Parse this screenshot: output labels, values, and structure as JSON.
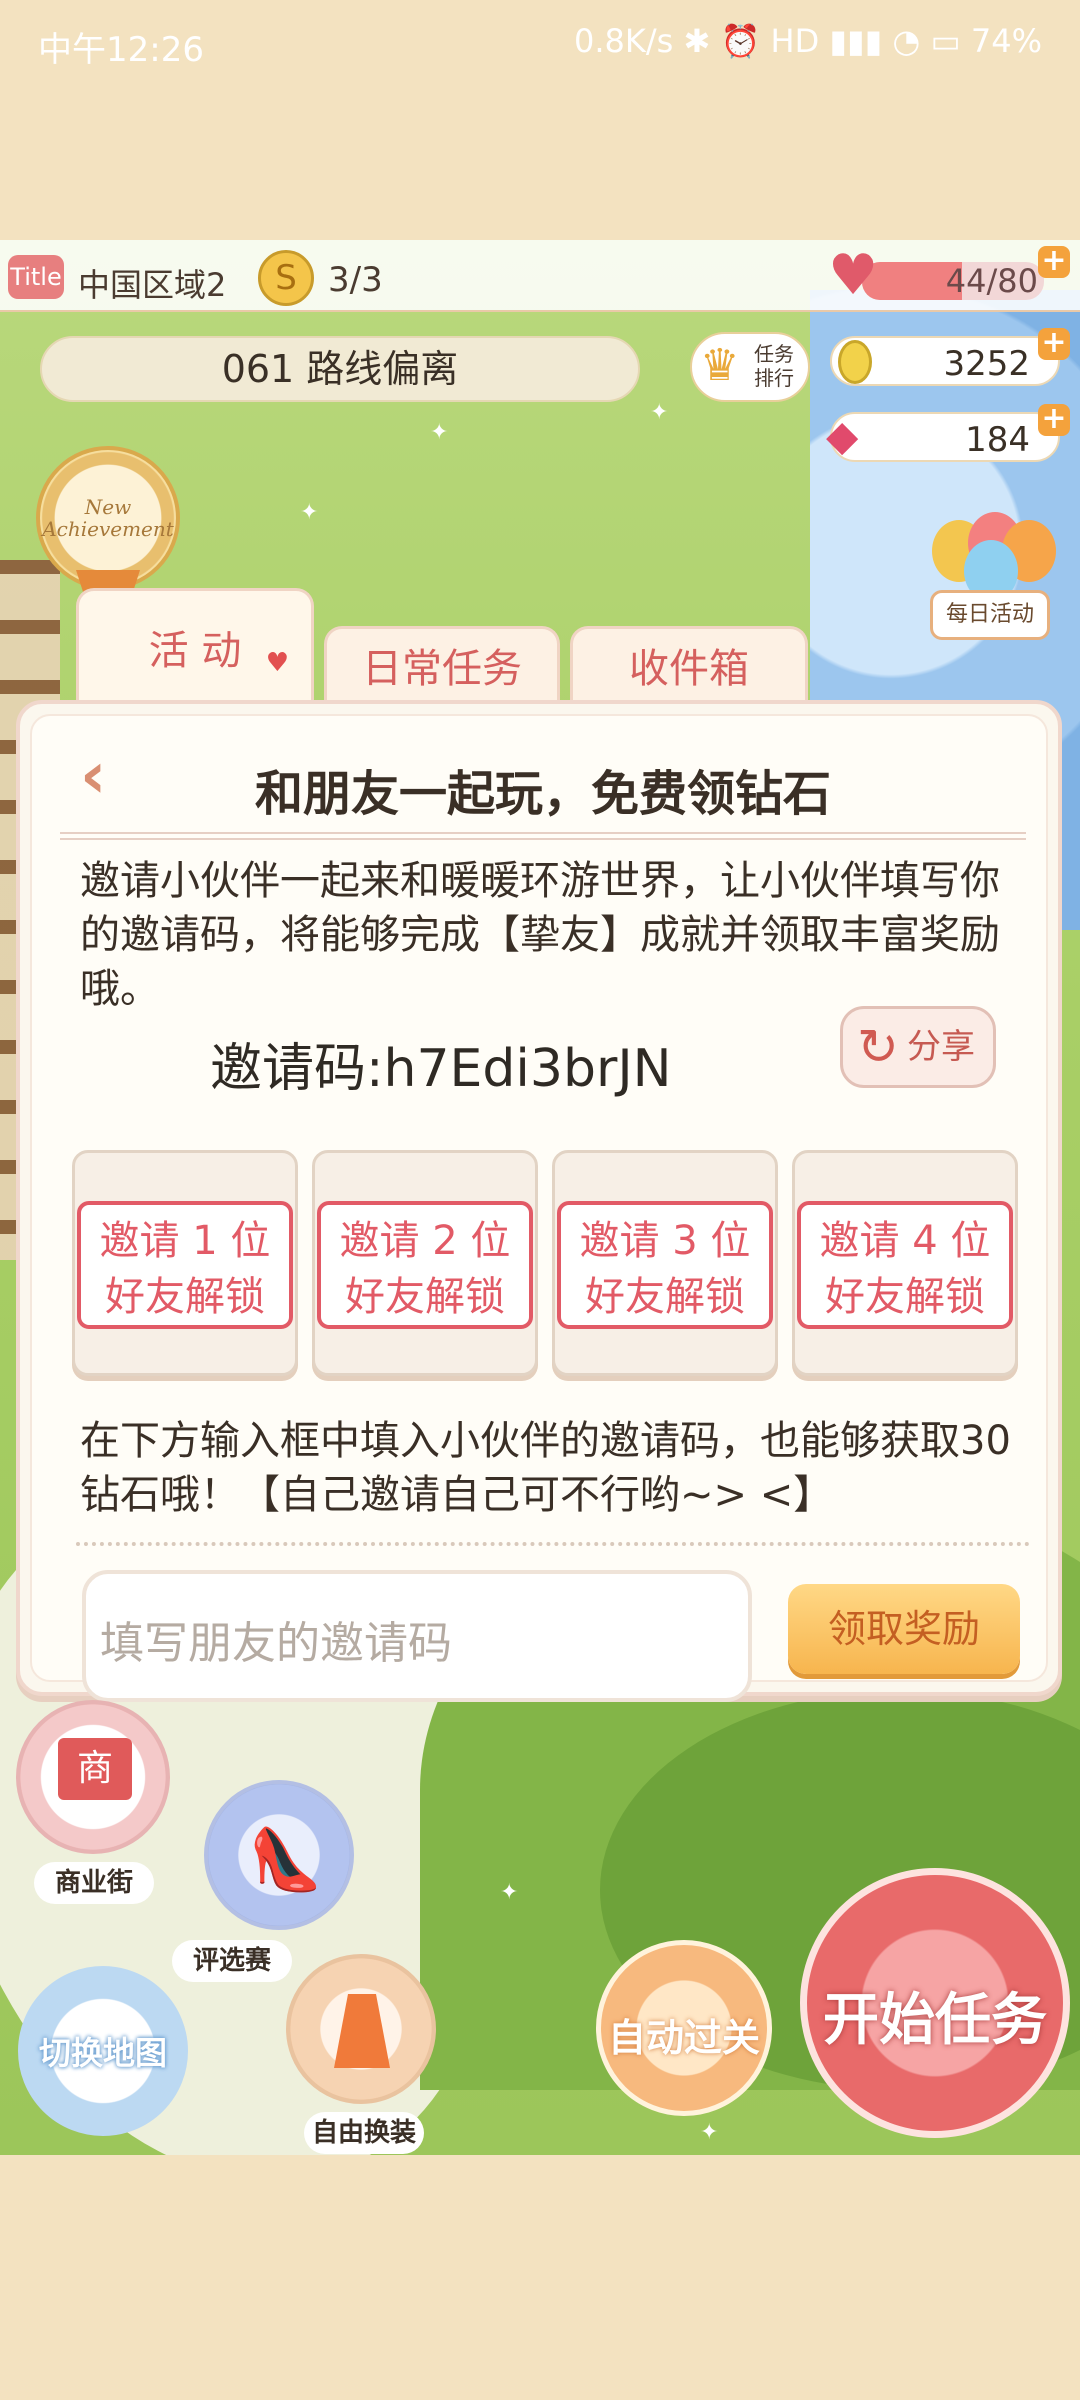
{
  "status_bar": {
    "left": "中午12:26",
    "right": "0.8K/s ✱ ⏰ HD ▮▮▮ ◔ ▭ 74%"
  },
  "top_bar": {
    "title_icon": "Title",
    "region": "中国区域2",
    "coin_symbol": "S",
    "quest_count": "3/3",
    "hp_text": "44/80",
    "hp_fraction": 0.55,
    "plus": "+"
  },
  "level": {
    "name": "061 路线偏离"
  },
  "rank_button": {
    "label_line1": "任务",
    "label_line2": "排行"
  },
  "resources": {
    "gold": "3252",
    "diamond": "184"
  },
  "badge": {
    "text": "New Achievement"
  },
  "daily_activity": {
    "label": "每日活动"
  },
  "tabs": [
    {
      "label": "活 动",
      "active": true
    },
    {
      "label": "日常任务",
      "active": false
    },
    {
      "label": "收件箱",
      "active": false
    }
  ],
  "panel": {
    "back_icon": "‹",
    "title": "和朋友一起玩，免费领钻石",
    "description": "邀请小伙伴一起来和暖暖环游世界，让小伙伴填写你的邀请码，将能够完成【挚友】成就并领取丰富奖励哦。",
    "invite_code": "邀请码:h7Edi3brJN",
    "share_label": "分享",
    "slots": [
      {
        "line1": "邀请 1 位",
        "line2": "好友解锁"
      },
      {
        "line1": "邀请 2 位",
        "line2": "好友解锁"
      },
      {
        "line1": "邀请 3 位",
        "line2": "好友解锁"
      },
      {
        "line1": "邀请 4 位",
        "line2": "好友解锁"
      }
    ],
    "bottom_description": "在下方输入框中填入小伙伴的邀请码，也能够获取30钻石哦！【自己邀请自己可不行哟~> <】",
    "input_placeholder": "填写朋友的邀请码",
    "claim_label": "领取奖励"
  },
  "bottom_buttons": {
    "shop_icon_text": "商",
    "shop_label": "商业街",
    "contest_label": "评选赛",
    "dress_label": "自由换装",
    "switch_map": "切换地图",
    "auto_pass": "自动过关",
    "start_task": "开始任务"
  },
  "colors": {
    "accent": "#e25a66",
    "button_orange": "#f7b54e",
    "start_red": "#e86a6a"
  }
}
